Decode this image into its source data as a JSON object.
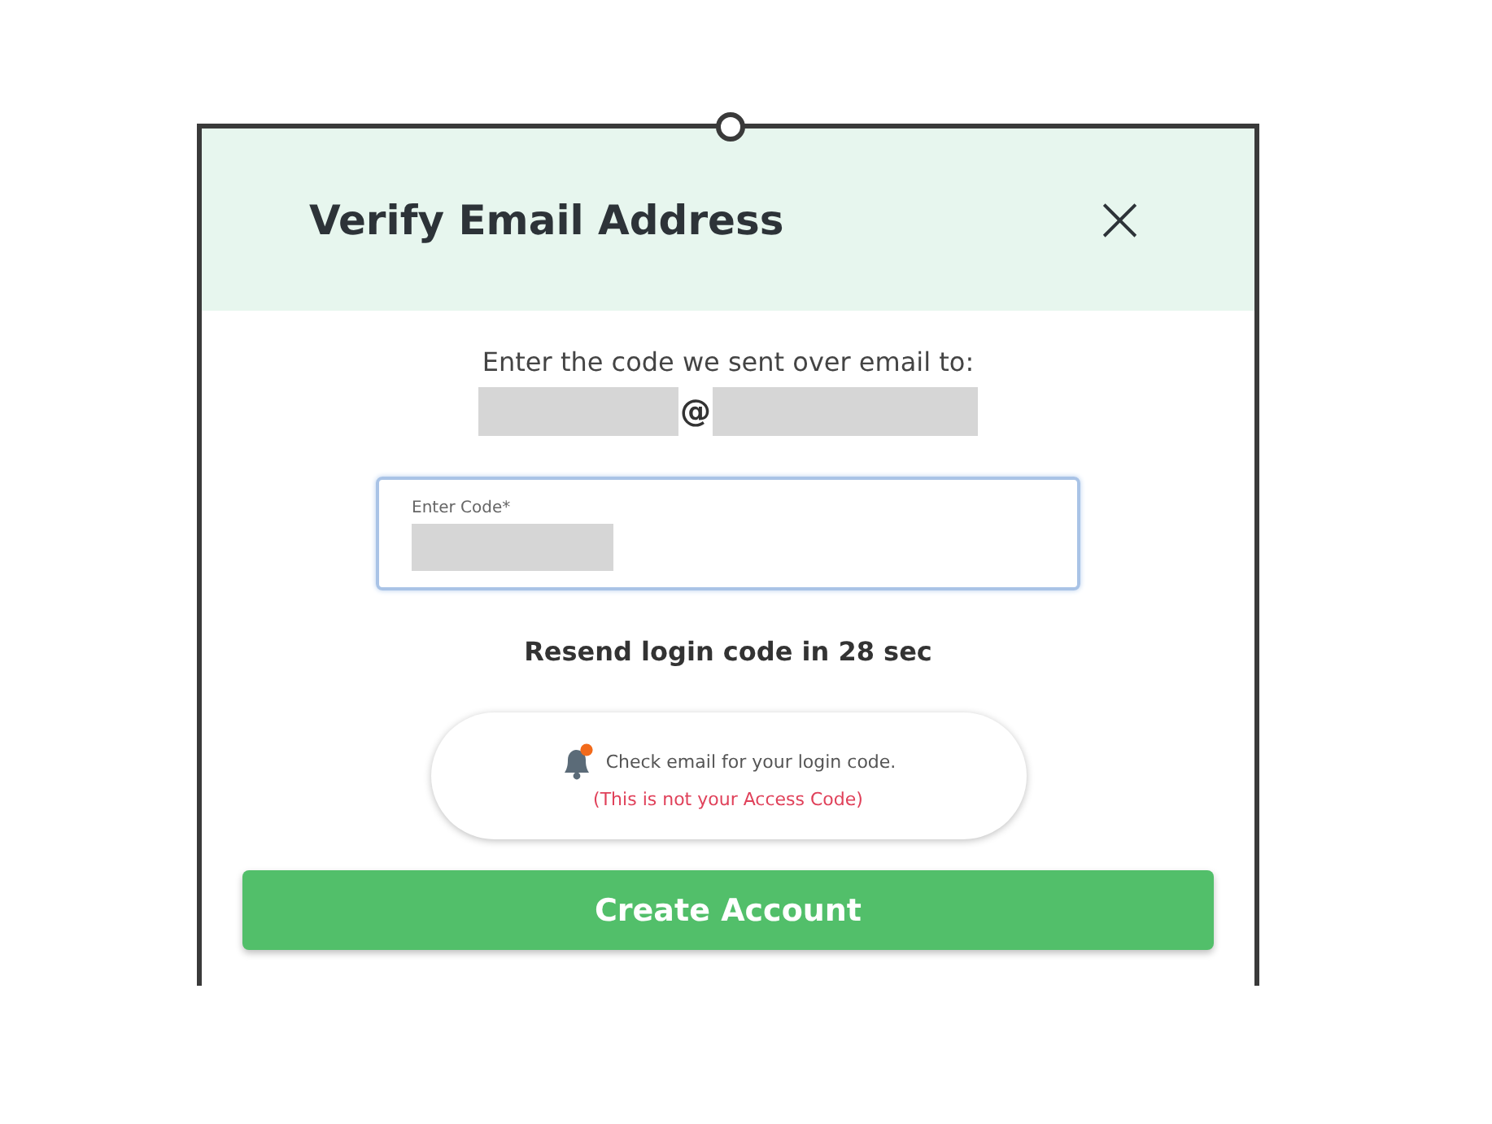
{
  "dialog": {
    "title": "Verify Email Address",
    "close_icon": "×"
  },
  "prompt": "Enter the code we sent over email to:",
  "email": {
    "separator": "@"
  },
  "code_field": {
    "label": "Enter Code*",
    "focused": true
  },
  "resend": "Resend login code in 28 sec",
  "notice": {
    "message": "Check email for your login code.",
    "warning": "(This is not your Access Code)"
  },
  "buttons": [
    {
      "label": "Create Account",
      "kind": "primary"
    }
  ]
}
